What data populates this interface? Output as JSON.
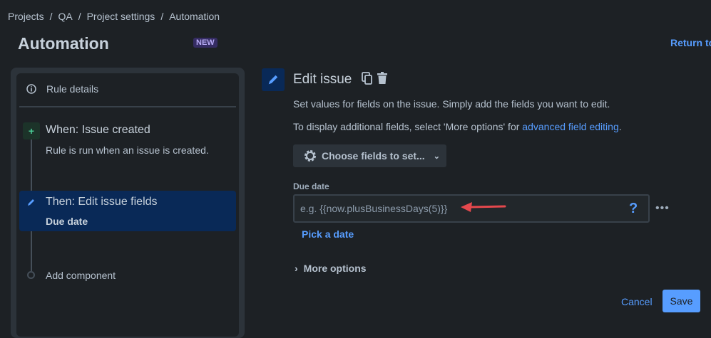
{
  "breadcrumb": [
    "Projects",
    "QA",
    "Project settings",
    "Automation"
  ],
  "header": {
    "title": "Automation",
    "badge": "NEW",
    "return_link": "Return to"
  },
  "sidebar": {
    "rule_details": "Rule details",
    "trigger": {
      "title": "When: Issue created",
      "subtitle": "Rule is run when an issue is created."
    },
    "action": {
      "title": "Then: Edit issue fields",
      "subtitle": "Due date"
    },
    "add_component": "Add component"
  },
  "main": {
    "title": "Edit issue",
    "desc1": "Set values for fields on the issue. Simply add the fields you want to edit.",
    "desc2_prefix": "To display additional fields, select 'More options' for ",
    "desc2_link": "advanced field editing",
    "desc2_suffix": ".",
    "choose_fields": "Choose fields to set...",
    "field_label": "Due date",
    "field_placeholder": "e.g. {{now.plusBusinessDays(5)}}",
    "help": "?",
    "pick_date": "Pick a date",
    "more_options": "More options",
    "cancel": "Cancel",
    "save": "Save"
  }
}
